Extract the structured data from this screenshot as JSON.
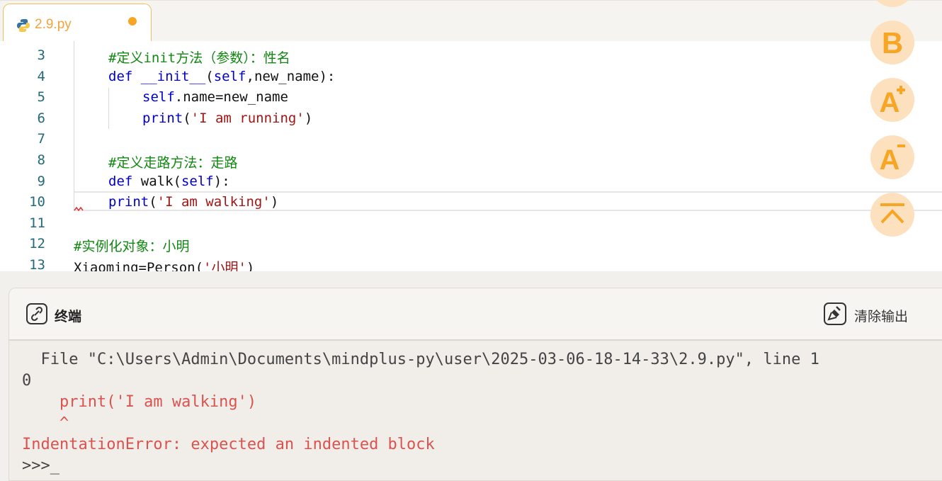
{
  "tab": {
    "filename": "2.9.py",
    "icon": "python-icon",
    "dirty_color": "#f6a524"
  },
  "editor": {
    "lines": [
      {
        "num": "3",
        "parts": [
          {
            "t": "#定义init方法（参数）：性名",
            "c": "cm"
          }
        ]
      },
      {
        "num": "4",
        "parts": [
          {
            "t": "def ",
            "c": "kw"
          },
          {
            "t": "__init__",
            "c": "kw"
          },
          {
            "t": "(",
            "c": "plain"
          },
          {
            "t": "self",
            "c": "kw"
          },
          {
            "t": ",new_name):",
            "c": "plain"
          }
        ]
      },
      {
        "num": "5",
        "parts": [
          {
            "t": "self",
            "c": "kw"
          },
          {
            "t": ".name=new_name",
            "c": "plain"
          }
        ]
      },
      {
        "num": "6",
        "parts": [
          {
            "t": "print",
            "c": "kw"
          },
          {
            "t": "(",
            "c": "plain"
          },
          {
            "t": "'I am running'",
            "c": "str"
          },
          {
            "t": ")",
            "c": "plain"
          }
        ]
      },
      {
        "num": "7",
        "parts": []
      },
      {
        "num": "8",
        "parts": [
          {
            "t": "#定义走路方法：走路",
            "c": "cm"
          }
        ]
      },
      {
        "num": "9",
        "parts": [
          {
            "t": "def ",
            "c": "kw"
          },
          {
            "t": "walk",
            "c": "plain"
          },
          {
            "t": "(",
            "c": "plain"
          },
          {
            "t": "self",
            "c": "kw"
          },
          {
            "t": "):",
            "c": "plain"
          }
        ]
      },
      {
        "num": "10",
        "parts": [
          {
            "t": "print",
            "c": "kw"
          },
          {
            "t": "(",
            "c": "plain"
          },
          {
            "t": "'I am walking'",
            "c": "str"
          },
          {
            "t": ")",
            "c": "plain"
          }
        ]
      },
      {
        "num": "11",
        "parts": []
      },
      {
        "num": "12",
        "parts": [
          {
            "t": "#实例化对象：小明",
            "c": "cm"
          }
        ]
      },
      {
        "num": "13",
        "parts": [
          {
            "t": "Xiaoming=Person(",
            "c": "plain"
          },
          {
            "t": "'小明'",
            "c": "str"
          },
          {
            "t": ")",
            "c": "plain"
          }
        ]
      }
    ]
  },
  "fabs": [
    {
      "name": "bold-button",
      "icon": "bold-b-icon"
    },
    {
      "name": "font-increase-button",
      "icon": "font-increase-icon"
    },
    {
      "name": "font-decrease-button",
      "icon": "font-decrease-icon"
    },
    {
      "name": "scroll-top-button",
      "icon": "scroll-to-top-icon"
    }
  ],
  "terminal": {
    "title": "终端",
    "clear_label": "清除输出",
    "output": [
      {
        "text": "  File \"C:\\Users\\Admin\\Documents\\mindplus-py\\user\\2025-03-06-18-14-33\\2.9.py\", line 1",
        "color": "gray"
      },
      {
        "text": "0",
        "color": "gray"
      },
      {
        "text": "    print('I am walking')",
        "color": "red"
      },
      {
        "text": "    ^",
        "color": "red"
      },
      {
        "text": "IndentationError: expected an indented block",
        "color": "red"
      },
      {
        "text": ">>>_",
        "color": "gray"
      }
    ]
  },
  "colors": {
    "accent": "#f6a524",
    "fab_bg": "#fde1bf",
    "error": "#d9534f"
  }
}
